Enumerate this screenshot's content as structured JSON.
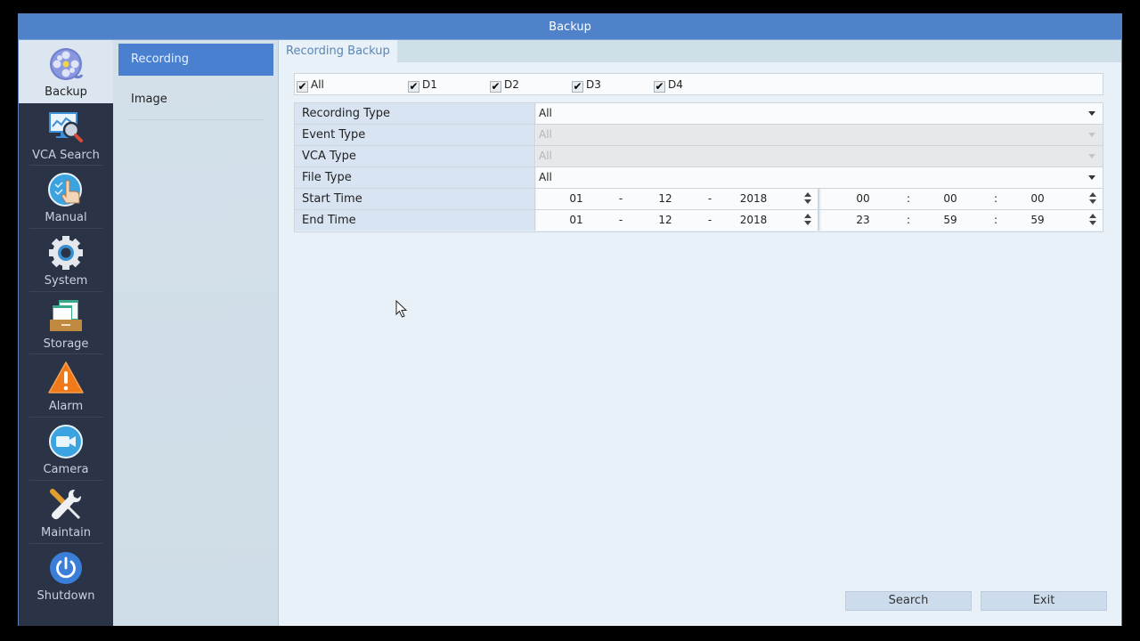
{
  "window": {
    "title": "Backup"
  },
  "nav": {
    "items": [
      {
        "label": "Backup",
        "icon": "film-reel-icon",
        "active": true
      },
      {
        "label": "VCA Search",
        "icon": "monitor-search-icon",
        "active": false
      },
      {
        "label": "Manual",
        "icon": "hand-pointer-icon",
        "active": false
      },
      {
        "label": "System",
        "icon": "gear-icon",
        "active": false
      },
      {
        "label": "Storage",
        "icon": "storage-tray-icon",
        "active": false
      },
      {
        "label": "Alarm",
        "icon": "warning-icon",
        "active": false
      },
      {
        "label": "Camera",
        "icon": "video-camera-icon",
        "active": false
      },
      {
        "label": "Maintain",
        "icon": "wrench-screwdriver-icon",
        "active": false
      },
      {
        "label": "Shutdown",
        "icon": "power-icon",
        "active": false
      }
    ]
  },
  "subnav": {
    "items": [
      {
        "label": "Recording",
        "active": true
      },
      {
        "label": "Image",
        "active": false
      }
    ]
  },
  "tab": {
    "label": "Recording Backup"
  },
  "channels": [
    {
      "label": "All",
      "checked": true,
      "glyph": "✔"
    },
    {
      "label": "D1",
      "checked": true,
      "glyph": "✔"
    },
    {
      "label": "D2",
      "checked": true,
      "glyph": "✔"
    },
    {
      "label": "D3",
      "checked": true,
      "glyph": "✔"
    },
    {
      "label": "D4",
      "checked": true,
      "glyph": "✔"
    }
  ],
  "form": {
    "recording_type": {
      "label": "Recording Type",
      "value": "All"
    },
    "event_type": {
      "label": "Event Type",
      "value": "All",
      "disabled": true
    },
    "vca_type": {
      "label": "VCA Type",
      "value": "All",
      "disabled": true
    },
    "file_type": {
      "label": "File Type",
      "value": "All"
    },
    "start_time": {
      "label": "Start Time",
      "date": {
        "day": "01",
        "month": "12",
        "year": "2018",
        "sep": "-"
      },
      "time": {
        "h": "00",
        "m": "00",
        "s": "00",
        "sep": ":"
      }
    },
    "end_time": {
      "label": "End Time",
      "date": {
        "day": "01",
        "month": "12",
        "year": "2018",
        "sep": "-"
      },
      "time": {
        "h": "23",
        "m": "59",
        "s": "59",
        "sep": ":"
      }
    }
  },
  "buttons": {
    "search": "Search",
    "exit": "Exit"
  }
}
